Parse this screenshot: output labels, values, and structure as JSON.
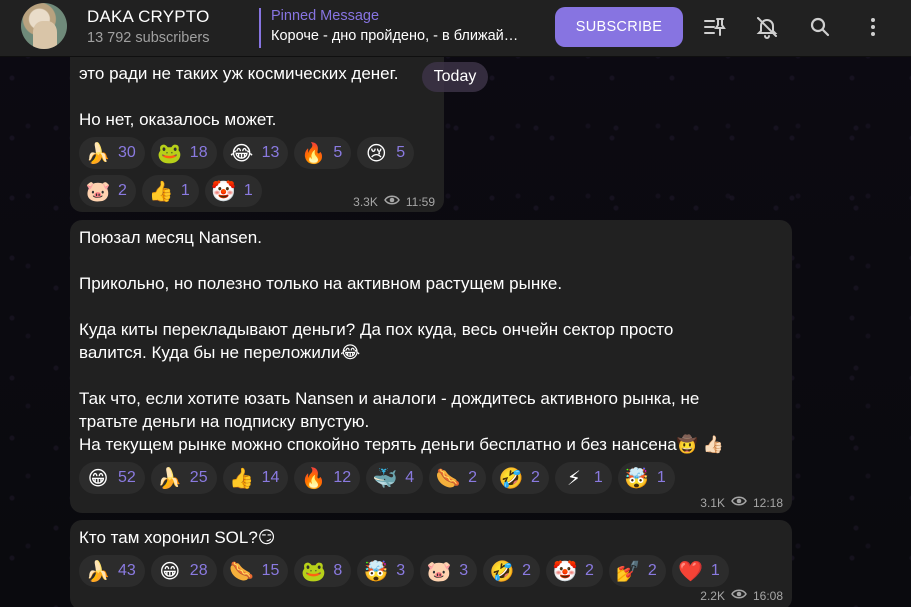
{
  "header": {
    "channel_title": "DAKA CRYPTO",
    "subscribers": "13 792 subscribers",
    "pinned_label": "Pinned Message",
    "pinned_text": "Короче - дно пройдено, - в ближай…",
    "subscribe_label": "SUBSCRIBE",
    "icons": [
      "pinned-list-icon",
      "bell-muted-icon",
      "search-icon",
      "more-vert-icon"
    ]
  },
  "date_pill": "Today",
  "messages": [
    {
      "lines": [
        "это ради не таких уж космических денег.",
        "",
        "Но нет, оказалось может."
      ],
      "reactions": [
        {
          "emoji": "🍌",
          "icon": "banana-icon",
          "count": "30"
        },
        {
          "emoji": "🐸",
          "icon": "frog-icon",
          "count": "18"
        },
        {
          "emoji": "😂",
          "icon": "laughing-icon",
          "count": "13"
        },
        {
          "emoji": "🔥",
          "icon": "fire-icon",
          "count": "5"
        },
        {
          "emoji": "😢",
          "icon": "crying-icon",
          "count": "5"
        },
        {
          "emoji": "🐷",
          "icon": "pig-icon",
          "count": "2"
        },
        {
          "emoji": "👍",
          "icon": "thumbs-up-icon",
          "count": "1"
        },
        {
          "emoji": "🤡",
          "icon": "face-icon",
          "count": "1"
        }
      ],
      "views": "3.3K",
      "time": "11:59"
    },
    {
      "lines": [
        "Поюзал месяц Nansen.",
        "",
        "Прикольно, но полезно только на активном растущем рынке.",
        "",
        "Куда киты перекладывают деньги? Да пох куда, весь ончейн сектор просто",
        "валится. Куда бы не переложили😂",
        "",
        "Так что, если хотите юзать Nansen и аналоги - дождитесь активного рынка, не",
        "тратьте деньги на подписку впустую.",
        "На текущем рынке можно спокойно терять деньги бесплатно и без нансена🤠 👍🏻"
      ],
      "reactions": [
        {
          "emoji": "😁",
          "icon": "grin-icon",
          "count": "52"
        },
        {
          "emoji": "🍌",
          "icon": "banana-icon",
          "count": "25"
        },
        {
          "emoji": "👍",
          "icon": "thumbs-up-icon",
          "count": "14"
        },
        {
          "emoji": "🔥",
          "icon": "fire-icon",
          "count": "12"
        },
        {
          "emoji": "🐳",
          "icon": "whale-icon",
          "count": "4"
        },
        {
          "emoji": "🌭",
          "icon": "hotdog-icon",
          "count": "2"
        },
        {
          "emoji": "🤣",
          "icon": "rofl-icon",
          "count": "2"
        },
        {
          "emoji": "⚡",
          "icon": "lightning-icon",
          "count": "1"
        },
        {
          "emoji": "🤯",
          "icon": "mind-blown-icon",
          "count": "1"
        }
      ],
      "views": "3.1K",
      "time": "12:18"
    },
    {
      "lines": [
        "Кто там хоронил SOL?😏"
      ],
      "reactions": [
        {
          "emoji": "🍌",
          "icon": "banana-icon",
          "count": "43"
        },
        {
          "emoji": "😁",
          "icon": "grin-icon",
          "count": "28"
        },
        {
          "emoji": "🌭",
          "icon": "hotdog-icon",
          "count": "15"
        },
        {
          "emoji": "🐸",
          "icon": "frog-icon",
          "count": "8"
        },
        {
          "emoji": "🤯",
          "icon": "mind-blown-icon",
          "count": "3"
        },
        {
          "emoji": "🐷",
          "icon": "pig-icon",
          "count": "3"
        },
        {
          "emoji": "🤣",
          "icon": "rofl-icon",
          "count": "2"
        },
        {
          "emoji": "🤡",
          "icon": "face-icon",
          "count": "2"
        },
        {
          "emoji": "💅",
          "icon": "nail-polish-icon",
          "count": "2"
        },
        {
          "emoji": "❤️",
          "icon": "heart-icon",
          "count": "1"
        }
      ],
      "views": "2.2K",
      "time": "16:08"
    }
  ],
  "colors": {
    "accent": "#8774e1",
    "header_bg": "#212121",
    "bubble_bg": "#212121",
    "reaction_bg": "#2c2c2c",
    "reaction_count": "#8a7ae0"
  }
}
